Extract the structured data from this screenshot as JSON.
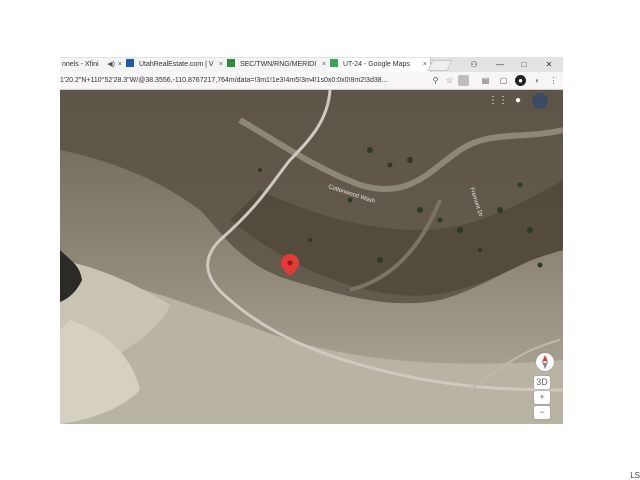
{
  "browser": {
    "tabs": [
      {
        "label": "nnels - Xfini",
        "favicon_color": "#4a4a4a"
      },
      {
        "label": "UtahRealEstate.com | V",
        "favicon_color": "#1e5aa8"
      },
      {
        "label": "SEC/TWN/RNG/MERIDI",
        "favicon_color": "#2e8b3a"
      },
      {
        "label": "UT-24 - Google Maps",
        "favicon_color": "#34a853"
      }
    ],
    "tab_close": "×",
    "address": "1'20.2\"N+110°52'28.3\"W/@38.3556,-110.8767217,764m/data=!3m1!1e3!4m5!3m4!1s0x0:0x0!8m2!3d38..."
  },
  "map": {
    "road_label_1": "Cottonwood Wash",
    "road_label_2": "Fremont Dr",
    "button_3d": "3D",
    "zoom_in": "+",
    "zoom_out": "−"
  },
  "watermark": "LS",
  "colors": {
    "marker": "#e53935",
    "road": "#cfc9bf"
  }
}
